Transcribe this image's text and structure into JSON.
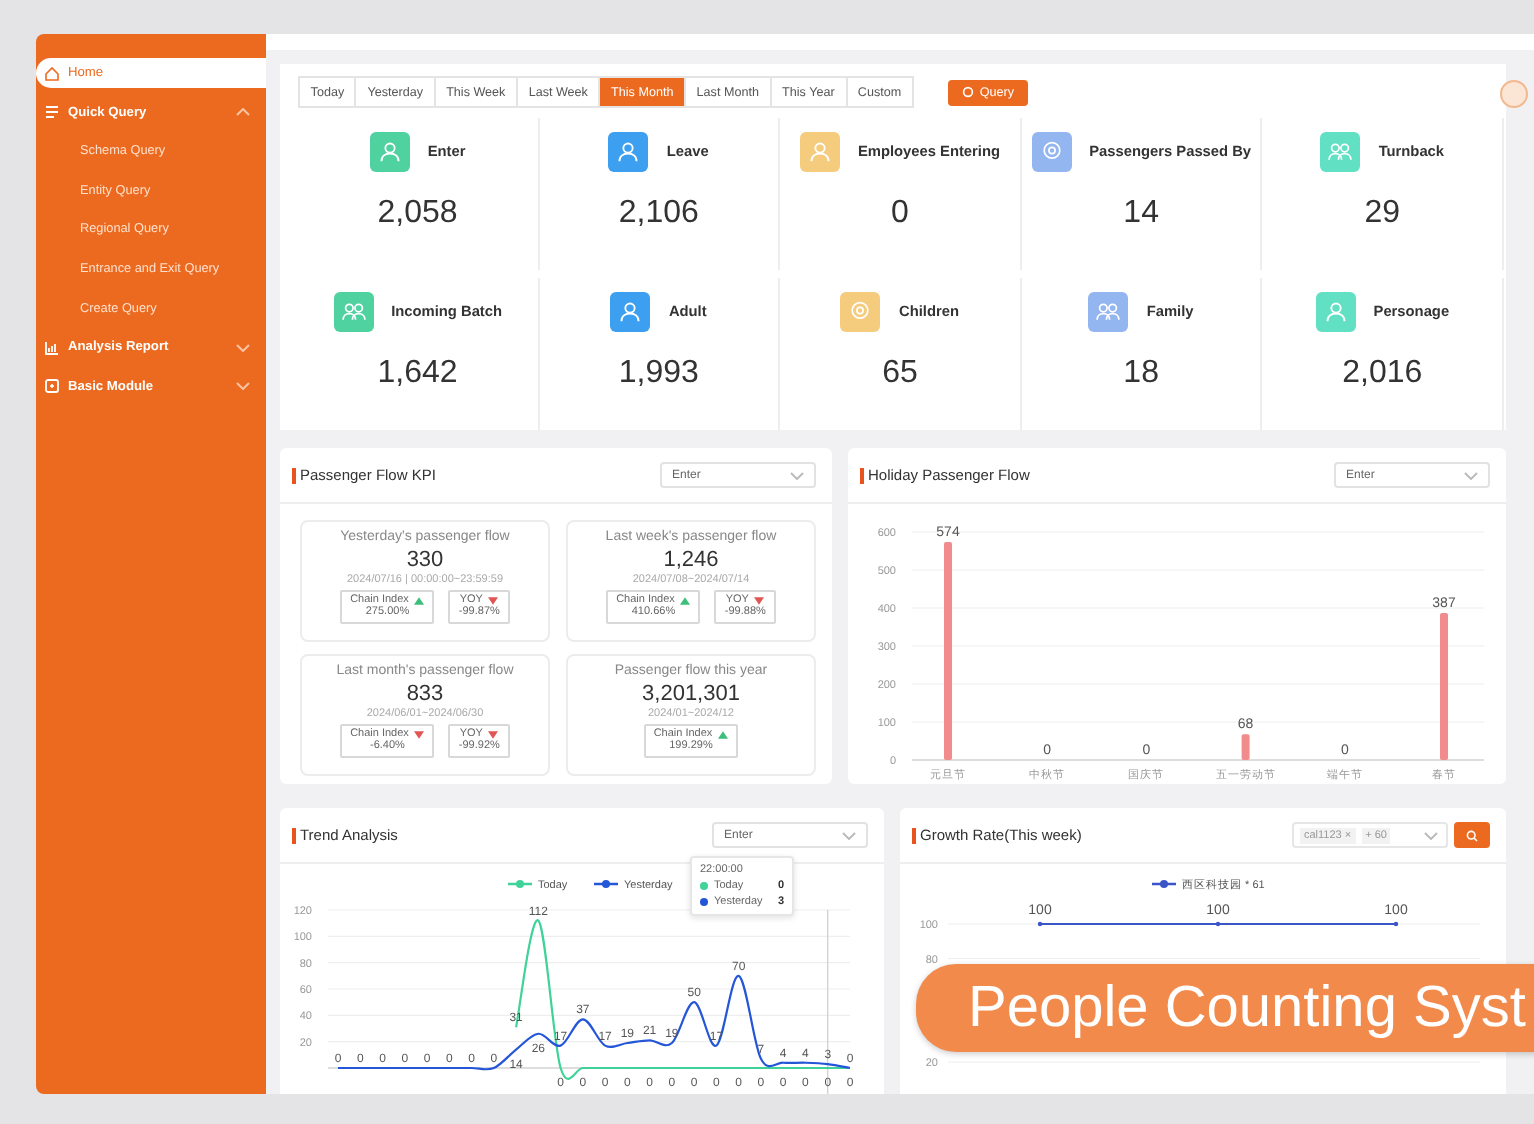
{
  "sidebar": {
    "items": [
      {
        "label": "Home",
        "selected": true
      },
      {
        "label": "Quick Query",
        "selected": false,
        "expanded": true,
        "children": [
          {
            "label": "Schema Query",
            "selected": false
          },
          {
            "label": "Entity Query",
            "selected": false
          },
          {
            "label": "Regional Query",
            "selected": false
          },
          {
            "label": "Entrance and Exit Query",
            "selected": false
          },
          {
            "label": "Create Query",
            "selected": false
          }
        ]
      },
      {
        "label": "Analysis Report",
        "selected": false,
        "expanded": false
      },
      {
        "label": "Basic Module",
        "selected": false,
        "expanded": false
      }
    ]
  },
  "date_tabs": [
    {
      "label": "Today",
      "selected": false
    },
    {
      "label": "Yesterday",
      "selected": false
    },
    {
      "label": "This Week",
      "selected": false
    },
    {
      "label": "Last Week",
      "selected": false
    },
    {
      "label": "This Month",
      "selected": true
    },
    {
      "label": "Last Month",
      "selected": false
    },
    {
      "label": "This Year",
      "selected": false
    },
    {
      "label": "Custom",
      "selected": false
    }
  ],
  "query_button": "Query",
  "stats": [
    {
      "label": "Enter",
      "value": "2,058",
      "color": "#4fd1a0"
    },
    {
      "label": "Leave",
      "value": "2,106",
      "color": "#3d9ff0"
    },
    {
      "label": "Employees Entering",
      "value": "0",
      "color": "#f5cb7d"
    },
    {
      "label": "Passengers Passed By",
      "value": "14",
      "color": "#93b5f0"
    },
    {
      "label": "Turnback",
      "value": "29",
      "color": "#62e0c4"
    },
    {
      "label": "Incoming Batch",
      "value": "1,642",
      "color": "#4fd1a0"
    },
    {
      "label": "Adult",
      "value": "1,993",
      "color": "#3d9ff0"
    },
    {
      "label": "Children",
      "value": "65",
      "color": "#f5cb7d"
    },
    {
      "label": "Family",
      "value": "18",
      "color": "#93b5f0"
    },
    {
      "label": "Personage",
      "value": "2,016",
      "color": "#62e0c4"
    }
  ],
  "kpi": {
    "title": "Passenger Flow KPI",
    "select": "Enter",
    "cells": [
      {
        "title": "Yesterday's passenger flow",
        "value": "330",
        "period": "2024/07/16 | 00:00:00~23:59:59",
        "indices": [
          {
            "label": "Chain Index",
            "value": "275.00%",
            "rising": true
          },
          {
            "label": "YOY",
            "value": "-99.87%",
            "rising": false
          }
        ]
      },
      {
        "title": "Last week's passenger flow",
        "value": "1,246",
        "period": "2024/07/08~2024/07/14",
        "indices": [
          {
            "label": "Chain Index",
            "value": "410.66%",
            "rising": true
          },
          {
            "label": "YOY",
            "value": "-99.88%",
            "rising": false
          }
        ]
      },
      {
        "title": "Last month's passenger flow",
        "value": "833",
        "period": "2024/06/01~2024/06/30",
        "indices": [
          {
            "label": "Chain Index",
            "value": "-6.40%",
            "rising": false
          },
          {
            "label": "YOY",
            "value": "-99.92%",
            "rising": false
          }
        ]
      },
      {
        "title": "Passenger flow this year",
        "value": "3,201,301",
        "period": "2024/01~2024/12",
        "indices": [
          {
            "label": "Chain Index",
            "value": "199.29%",
            "rising": true
          }
        ]
      }
    ]
  },
  "holiday": {
    "title": "Holiday Passenger Flow",
    "select": "Enter",
    "chart_data": {
      "type": "bar",
      "categories": [
        "元旦节",
        "中秋节",
        "国庆节",
        "五一劳动节",
        "端午节",
        "春节"
      ],
      "values": [
        574,
        0,
        0,
        68,
        0,
        387
      ],
      "ylim": [
        0,
        600
      ],
      "yticks": [
        0,
        100,
        200,
        300,
        400,
        500,
        600
      ],
      "grid": true,
      "data_labels": true
    }
  },
  "trend": {
    "title": "Trend Analysis",
    "select": "Enter",
    "chart_data": {
      "type": "line",
      "series": [
        {
          "name": "Today",
          "color": "#3fd39a",
          "values": [
            null,
            null,
            null,
            null,
            null,
            null,
            null,
            null,
            31,
            112,
            0,
            0,
            0,
            0,
            0,
            0,
            0,
            0,
            0,
            0,
            0,
            0,
            0,
            0
          ]
        },
        {
          "name": "Yesterday",
          "color": "#2456d8",
          "values": [
            0,
            0,
            0,
            0,
            0,
            0,
            0,
            0,
            14,
            26,
            17,
            37,
            17,
            19,
            21,
            19,
            50,
            17,
            70,
            7,
            4,
            4,
            3,
            0
          ]
        }
      ],
      "ylim": [
        0,
        120
      ],
      "yticks": [
        20,
        40,
        60,
        80,
        100,
        120
      ],
      "grid": true,
      "legend": "top",
      "data_labels": true
    },
    "tooltip": {
      "title": "22:00:00",
      "rows": [
        {
          "name": "Today",
          "value": "0",
          "color": "#3fd39a"
        },
        {
          "name": "Yesterday",
          "value": "3",
          "color": "#2456d8"
        }
      ]
    }
  },
  "growth": {
    "title": "Growth Rate(This week)",
    "filters": [
      "cal1123 ×",
      "+ 60"
    ],
    "chart_data": {
      "type": "line",
      "series": [
        {
          "name": "西区科技园 * 61",
          "color": "#3a55c8",
          "values": [
            100,
            100,
            100
          ]
        }
      ],
      "ylim": [
        20,
        100
      ],
      "yticks": [
        20,
        80,
        100
      ],
      "grid": true,
      "legend": "top",
      "data_labels": true
    }
  },
  "banner": {
    "text": "People Counting Syst"
  }
}
